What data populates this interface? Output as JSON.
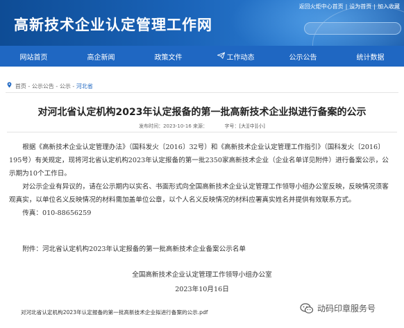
{
  "header": {
    "site_title": "高新技术企业认定管理工作网",
    "top_links": [
      "返回火炬中心首页",
      "设为首页",
      "加入收藏"
    ]
  },
  "nav": {
    "items": [
      "网站首页",
      "高企新闻",
      "政策文件",
      "工作动态",
      "公示公告",
      "统计数据"
    ]
  },
  "breadcrumb": [
    "首页",
    "公示公告",
    "公示",
    "河北省"
  ],
  "article": {
    "title": "对河北省认定机构2023年认定报备的第一批高新技术企业拟进行备案的公示",
    "publish_label": "发布时间：",
    "publish_date": "2023-10-16",
    "source_label": "来源：",
    "fontsize_label": "字号：",
    "fontsize_options": [
      "大",
      "中",
      "小"
    ],
    "paragraphs": [
      "根据《高新技术企业认定管理办法》（国科发火〔2016〕32号）和《高新技术企业认定管理工作指引》（国科发火〔2016〕195号）有关规定，现将河北省认定机构2023年认定报备的第一批2350家高新技术企业（企业名单详见附件）进行备案公示，公示期为10个工作日。",
      "对公示企业有异议的，请在公示期内以实名、书面形式向全国高新技术企业认定管理工作领导小组办公室反映，反映情况须客观真实，以单位名义反映情况的材料需加盖单位公章，以个人名义反映情况的材料应署真实姓名并提供有效联系方式。",
      "传真：010-88656259",
      "附件：河北省认定机构2023年认定报备的第一批高新技术企业备案公示名单"
    ],
    "signature": "全国高新技术企业认定管理工作领导小组办公室",
    "date": "2023年10月16日",
    "attachment_link": "对河北省认定机构2023年认定报备的第一批高新技术企业拟进行备案的公示.pdf"
  },
  "watermark": {
    "text": "动码印章服务号",
    "icon": "wechat-icon"
  }
}
